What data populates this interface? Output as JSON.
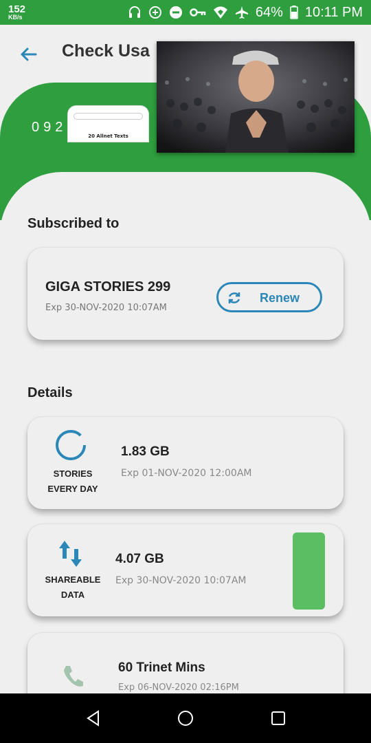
{
  "status_bar": {
    "net_speed": "152",
    "net_speed_unit": "KB/s",
    "battery": "64%",
    "time": "10:11 PM",
    "icons": [
      "headset-icon",
      "data-saver-icon",
      "dnd-icon",
      "vpn-key-icon",
      "wifi-icon",
      "airplane-icon",
      "battery-icon"
    ]
  },
  "header": {
    "title": "Check Usa",
    "account_number": "092",
    "promo_text": "20 Allnet Texts"
  },
  "subscribed": {
    "section_title": "Subscribed to",
    "plan_name": "GIGA STORIES 299",
    "plan_exp": "Exp 30-NOV-2020 10:07AM",
    "renew_label": "Renew"
  },
  "details": {
    "section_title": "Details",
    "items": [
      {
        "label_line1": "STORIES",
        "label_line2": "EVERY DAY",
        "amount": "1.83 GB",
        "exp": "Exp 01-NOV-2020 12:00AM",
        "icon": "ring-icon"
      },
      {
        "label_line1": "SHAREABLE",
        "label_line2": "DATA",
        "amount": "4.07 GB",
        "exp": "Exp 30-NOV-2020 10:07AM",
        "icon": "transfer-arrows-icon"
      },
      {
        "label_line1": "",
        "label_line2": "",
        "amount": "60 Trinet Mins",
        "exp": "Exp 06-NOV-2020 02:16PM",
        "icon": "phone-icon"
      }
    ]
  },
  "colors": {
    "brand_green": "#2e9e3e",
    "accent_blue": "#2a87b8",
    "tile_green": "#5cbe62"
  },
  "nav": {
    "icons": [
      "back-nav-icon",
      "home-nav-icon",
      "recents-nav-icon"
    ]
  }
}
